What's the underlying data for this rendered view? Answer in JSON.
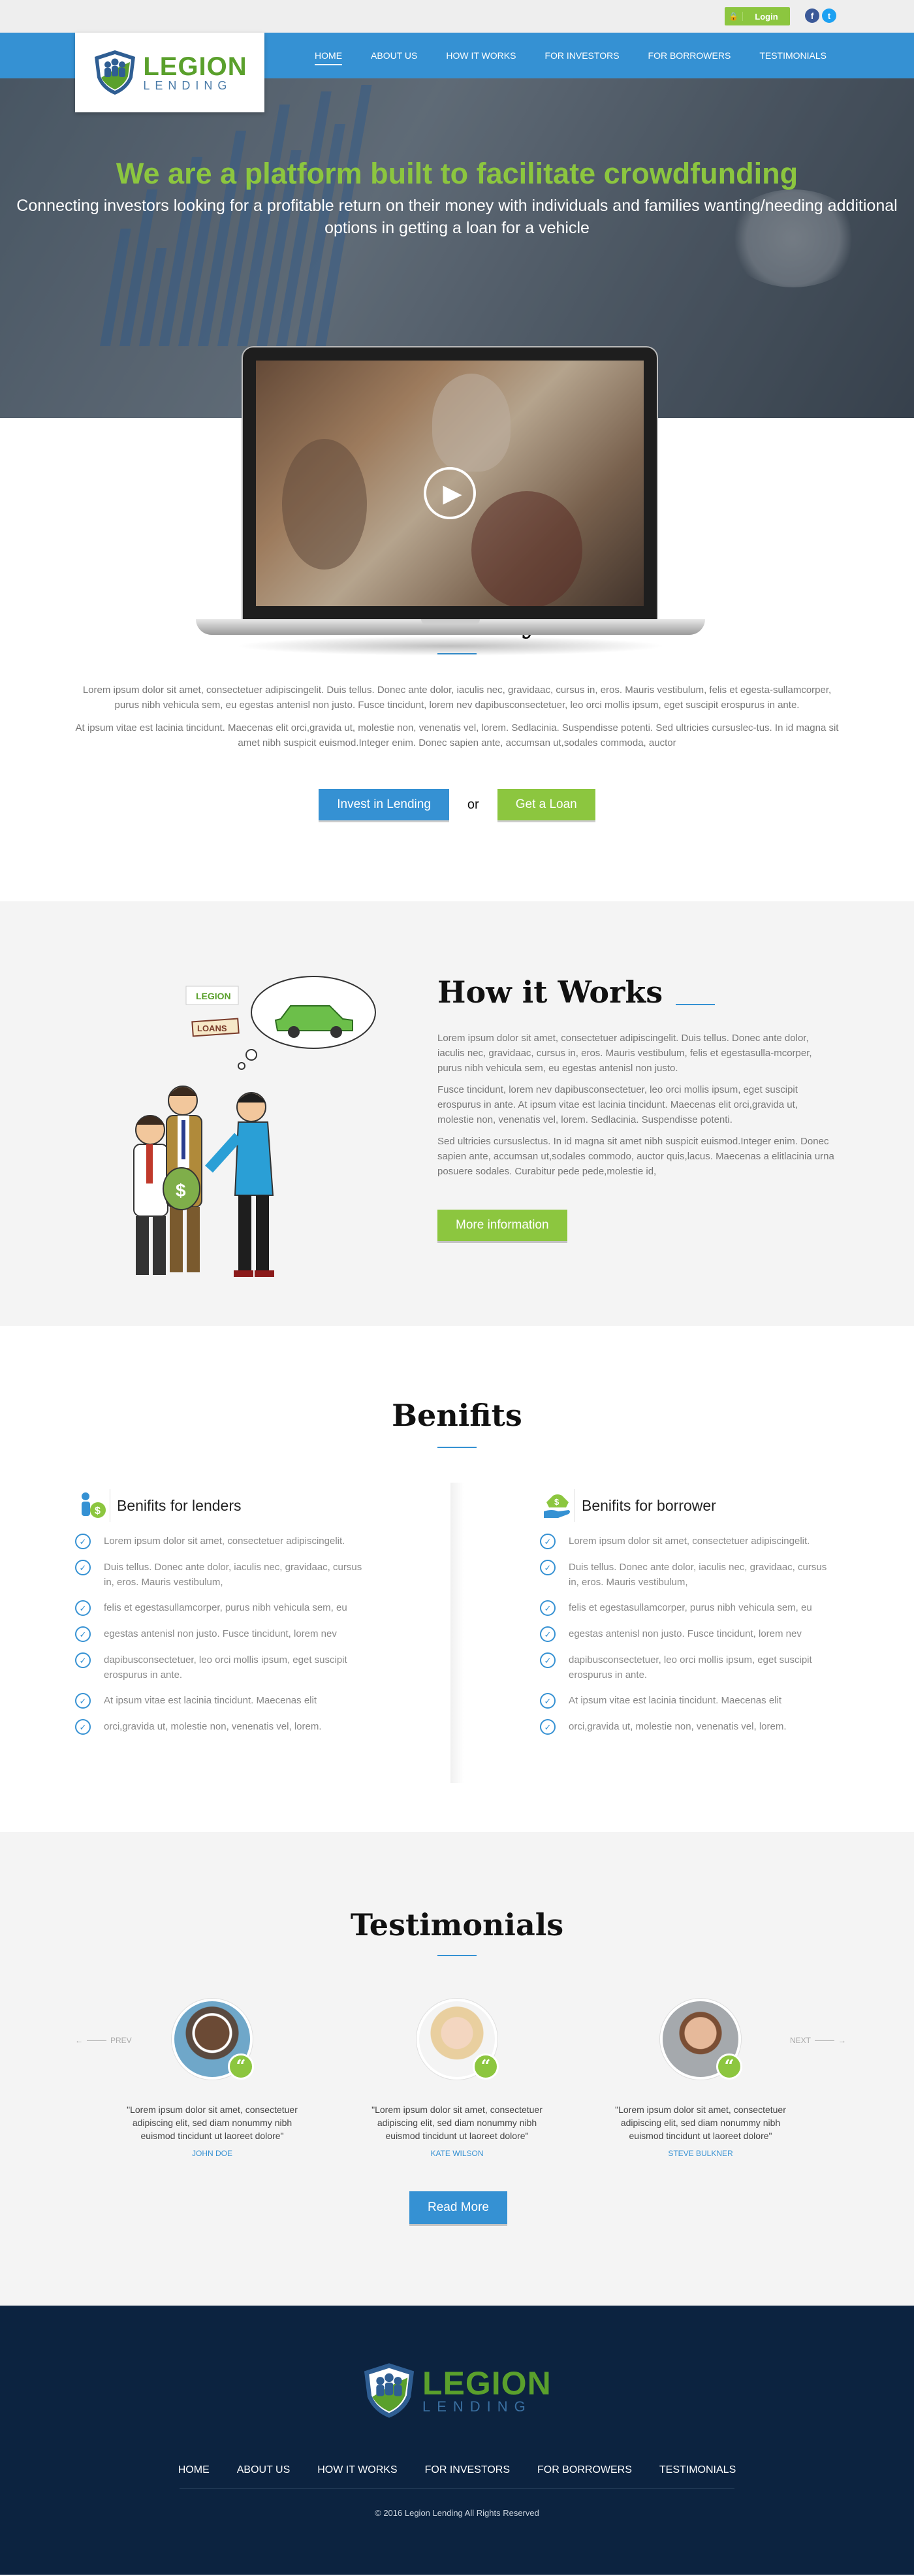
{
  "header": {
    "login_label": "Login",
    "login_icon": "lock-icon",
    "social": [
      {
        "name": "facebook-icon",
        "glyph": "f",
        "color": "#3b5998"
      },
      {
        "name": "twitter-icon",
        "glyph": "t",
        "color": "#1da1f2"
      }
    ],
    "logo": {
      "line1": "LEGION",
      "line2": "LENDING"
    },
    "nav": [
      "HOME",
      "ABOUT US",
      "HOW IT WORKS",
      "FOR INVESTORS",
      "FOR BORROWERS",
      "TESTIMONIALS"
    ]
  },
  "hero": {
    "title": "We are a platform built to facilitate crowdfunding",
    "subtitle": "Connecting investors looking for a profitable return on their money with individuals and families wanting/needing additional options in getting a loan for a vehicle"
  },
  "story": {
    "title": "Our Story",
    "p1": "Lorem ipsum dolor sit amet, consectetuer adipiscingelit. Duis tellus. Donec ante dolor, iaculis nec, gravidaac, cursus in, eros. Mauris vestibulum, felis et egesta-sullamcorper, purus nibh vehicula sem, eu egestas antenisl non justo. Fusce tincidunt, lorem nev dapibusconsectetuer, leo orci mollis ipsum, eget suscipit erospurus in ante.",
    "p2": "At ipsum vitae est lacinia tincidunt. Maecenas elit orci,gravida ut, molestie non, venenatis vel, lorem. Sedlacinia. Suspendisse potenti. Sed ultricies cursuslec-tus. In id magna sit amet nibh suspicit euismod.Integer enim. Donec sapien ante, accumsan ut,sodales commoda, auctor",
    "btn_invest": "Invest in Lending",
    "or": "or",
    "btn_loan": "Get a Loan"
  },
  "how": {
    "title": "How it Works",
    "p1": "Lorem ipsum dolor sit amet, consectetuer adipiscingelit. Duis tellus. Donec ante dolor, iaculis nec, gravidaac, cursus in, eros. Mauris vestibulum, felis et egestasulla-mcorper, purus nibh vehicula sem, eu egestas antenisl non justo.",
    "p2": "Fusce tincidunt, lorem nev dapibusconsectetuer, leo orci mollis ipsum, eget suscipit erospurus in ante. At ipsum vitae est lacinia tincidunt. Maecenas elit orci,gravida ut, molestie non, venenatis vel, lorem. Sedlacinia. Suspendisse potenti.",
    "p3": "Sed ultricies cursuslectus. In id magna sit amet nibh suspicit euismod.Integer enim. Donec sapien ante, accumsan ut,sodales commodo, auctor quis,lacus. Maecenas a elitlacinia urna posuere sodales. Curabitur pede pede,molestie id,",
    "btn": "More information",
    "illus_logo": "LEGION",
    "illus_sign": "LOANS"
  },
  "benefits": {
    "title": "Benifits",
    "lenders": {
      "title": "Benifits for lenders",
      "icon": "lender-money-icon",
      "items": [
        "Lorem ipsum dolor sit amet, consectetuer adipiscingelit.",
        "Duis tellus. Donec ante dolor, iaculis nec, gravidaac, cursus in, eros. Mauris vestibulum,",
        "felis et egestasullamcorper, purus nibh vehicula sem, eu",
        "egestas antenisl non justo. Fusce tincidunt, lorem nev",
        "dapibusconsectetuer, leo orci mollis ipsum, eget suscipit erospurus in ante.",
        "At ipsum vitae est lacinia tincidunt. Maecenas elit",
        "orci,gravida ut, molestie non, venenatis vel, lorem."
      ]
    },
    "borrowers": {
      "title": "Benifits for borrower",
      "icon": "hand-money-icon",
      "items": [
        "Lorem ipsum dolor sit amet, consectetuer adipiscingelit.",
        "Duis tellus. Donec ante dolor, iaculis nec, gravidaac, cursus in, eros. Mauris vestibulum,",
        "felis et egestasullamcorper, purus nibh vehicula sem, eu",
        "egestas antenisl non justo. Fusce tincidunt, lorem nev",
        "dapibusconsectetuer, leo orci mollis ipsum, eget suscipit erospurus in ante.",
        "At ipsum vitae est lacinia tincidunt. Maecenas elit",
        "orci,gravida ut, molestie non, venenatis vel, lorem."
      ]
    }
  },
  "testimonials": {
    "title": "Testimonials",
    "prev": "PREV",
    "next": "NEXT",
    "items": [
      {
        "quote": "\"Lorem ipsum dolor sit amet, consectetuer adipiscing elit, sed diam nonummy nibh euismod tincidunt ut laoreet dolore\"",
        "name": "JOHN DOE"
      },
      {
        "quote": "\"Lorem ipsum dolor sit amet, consectetuer adipiscing elit, sed diam nonummy nibh euismod tincidunt ut laoreet dolore\"",
        "name": "KATE WILSON"
      },
      {
        "quote": "\"Lorem ipsum dolor sit amet, consectetuer adipiscing elit, sed diam nonummy nibh euismod tincidunt ut laoreet dolore\"",
        "name": "STEVE BULKNER"
      }
    ],
    "btn": "Read More"
  },
  "footer": {
    "logo": {
      "line1": "LEGION",
      "line2": "LENDING"
    },
    "nav": [
      "HOME",
      "ABOUT US",
      "HOW IT WORKS",
      "FOR INVESTORS",
      "FOR BORROWERS",
      "TESTIMONIALS"
    ],
    "copyright": "© 2016 Legion Lending All Rights Reserved"
  },
  "colors": {
    "brand_blue": "#3591d3",
    "brand_green": "#8cc63f",
    "footer_bg": "#0c2340",
    "section_grey": "#f4f4f4"
  }
}
